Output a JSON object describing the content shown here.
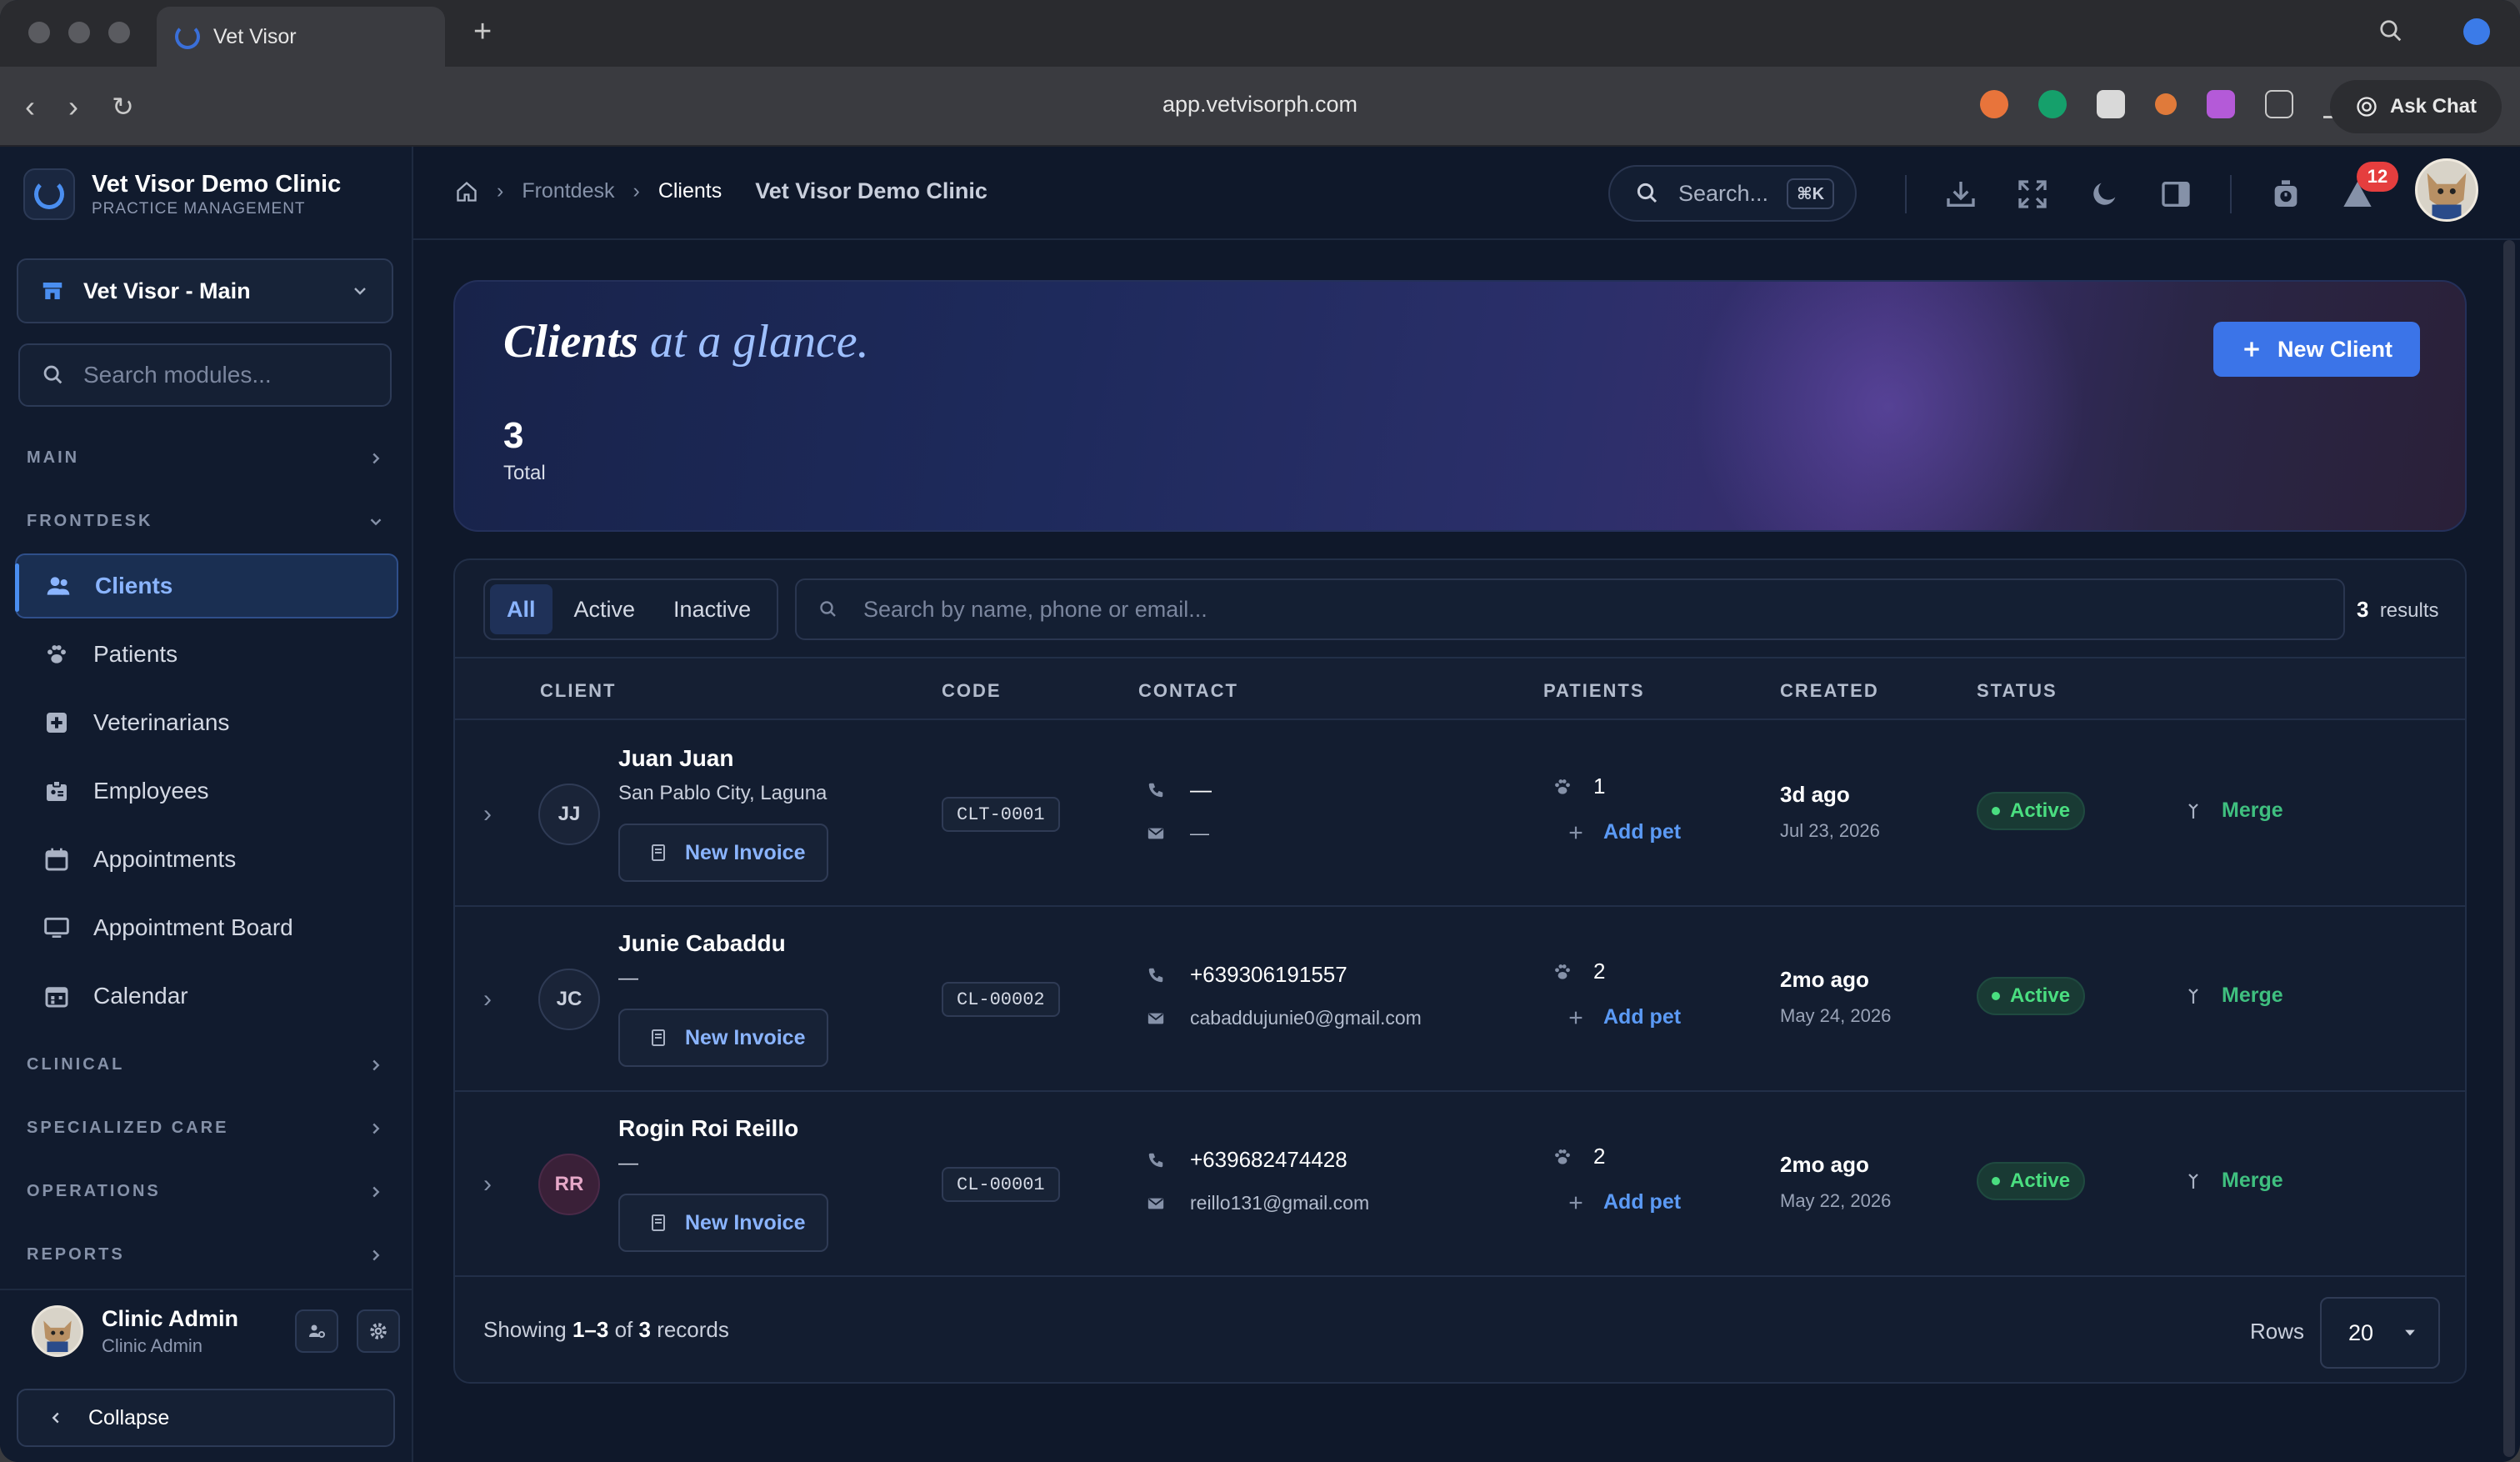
{
  "browser": {
    "tab_title": "Vet Visor",
    "url": "app.vetvisorph.com",
    "ask_chat": "Ask Chat"
  },
  "sidebar": {
    "clinic_name": "Vet Visor Demo Clinic",
    "clinic_subtitle": "PRACTICE MANAGEMENT",
    "branch": "Vet Visor - Main",
    "search_placeholder": "Search modules...",
    "sections": {
      "main": "MAIN",
      "frontdesk": "FRONTDESK",
      "clinical": "CLINICAL",
      "specialized_care": "SPECIALIZED CARE",
      "operations": "OPERATIONS",
      "reports": "REPORTS"
    },
    "items": [
      {
        "label": "Clients",
        "icon": "users-icon",
        "active": true
      },
      {
        "label": "Patients",
        "icon": "paw-icon"
      },
      {
        "label": "Veterinarians",
        "icon": "medical-cross-icon"
      },
      {
        "label": "Employees",
        "icon": "id-badge-icon"
      },
      {
        "label": "Appointments",
        "icon": "calendar-icon"
      },
      {
        "label": "Appointment Board",
        "icon": "monitor-icon"
      },
      {
        "label": "Calendar",
        "icon": "calendar-grid-icon"
      }
    ],
    "user": {
      "name": "Clinic Admin",
      "role": "Clinic Admin"
    },
    "collapse_label": "Collapse"
  },
  "header": {
    "breadcrumbs": [
      "Frontdesk",
      "Clients"
    ],
    "clinic": "Vet Visor Demo Clinic",
    "search_label": "Search...",
    "search_shortcut": "⌘K",
    "notification_count": "12"
  },
  "hero": {
    "title_main": "Clients",
    "title_accent": " at a glance.",
    "total_count": "3",
    "total_label": "Total",
    "new_client_label": "New Client"
  },
  "filters": {
    "all": "All",
    "active": "Active",
    "inactive": "Inactive",
    "search_placeholder": "Search by name, phone or email...",
    "result_count": "3",
    "result_label": "results"
  },
  "table": {
    "columns": {
      "client": "CLIENT",
      "code": "CODE",
      "contact": "CONTACT",
      "patients": "PATIENTS",
      "created": "CREATED",
      "status": "STATUS"
    },
    "invoice_label": "New Invoice",
    "add_pet_label": "Add pet",
    "merge_label": "Merge",
    "rows": [
      {
        "initials": "JJ",
        "name": "Juan Juan",
        "address": "San Pablo City, Laguna",
        "code": "CLT-0001",
        "phone": "—",
        "email": "—",
        "patients": "1",
        "created_relative": "3d ago",
        "created_date": "Jul 23, 2026",
        "status": "Active"
      },
      {
        "initials": "JC",
        "name": "Junie Cabaddu",
        "address": "—",
        "code": "CL-00002",
        "phone": "+639306191557",
        "email": "cabaddujunie0@gmail.com",
        "patients": "2",
        "created_relative": "2mo ago",
        "created_date": "May 24, 2026",
        "status": "Active"
      },
      {
        "initials": "RR",
        "name": "Rogin Roi Reillo",
        "address": "—",
        "code": "CL-00001",
        "phone": "+639682474428",
        "email": "reillo131@gmail.com",
        "patients": "2",
        "created_relative": "2mo ago",
        "created_date": "May 22, 2026",
        "status": "Active"
      }
    ]
  },
  "footer": {
    "showing_prefix": "Showing ",
    "showing_range": "1–3",
    "showing_of": " of ",
    "showing_total": "3",
    "showing_suffix": " records",
    "rows_label": "Rows",
    "rows_value": "20"
  },
  "colors": {
    "accent": "#3b74e8",
    "active_status": "#4ade80",
    "merge": "#3fbf7f",
    "badge": "#e53e3e"
  }
}
